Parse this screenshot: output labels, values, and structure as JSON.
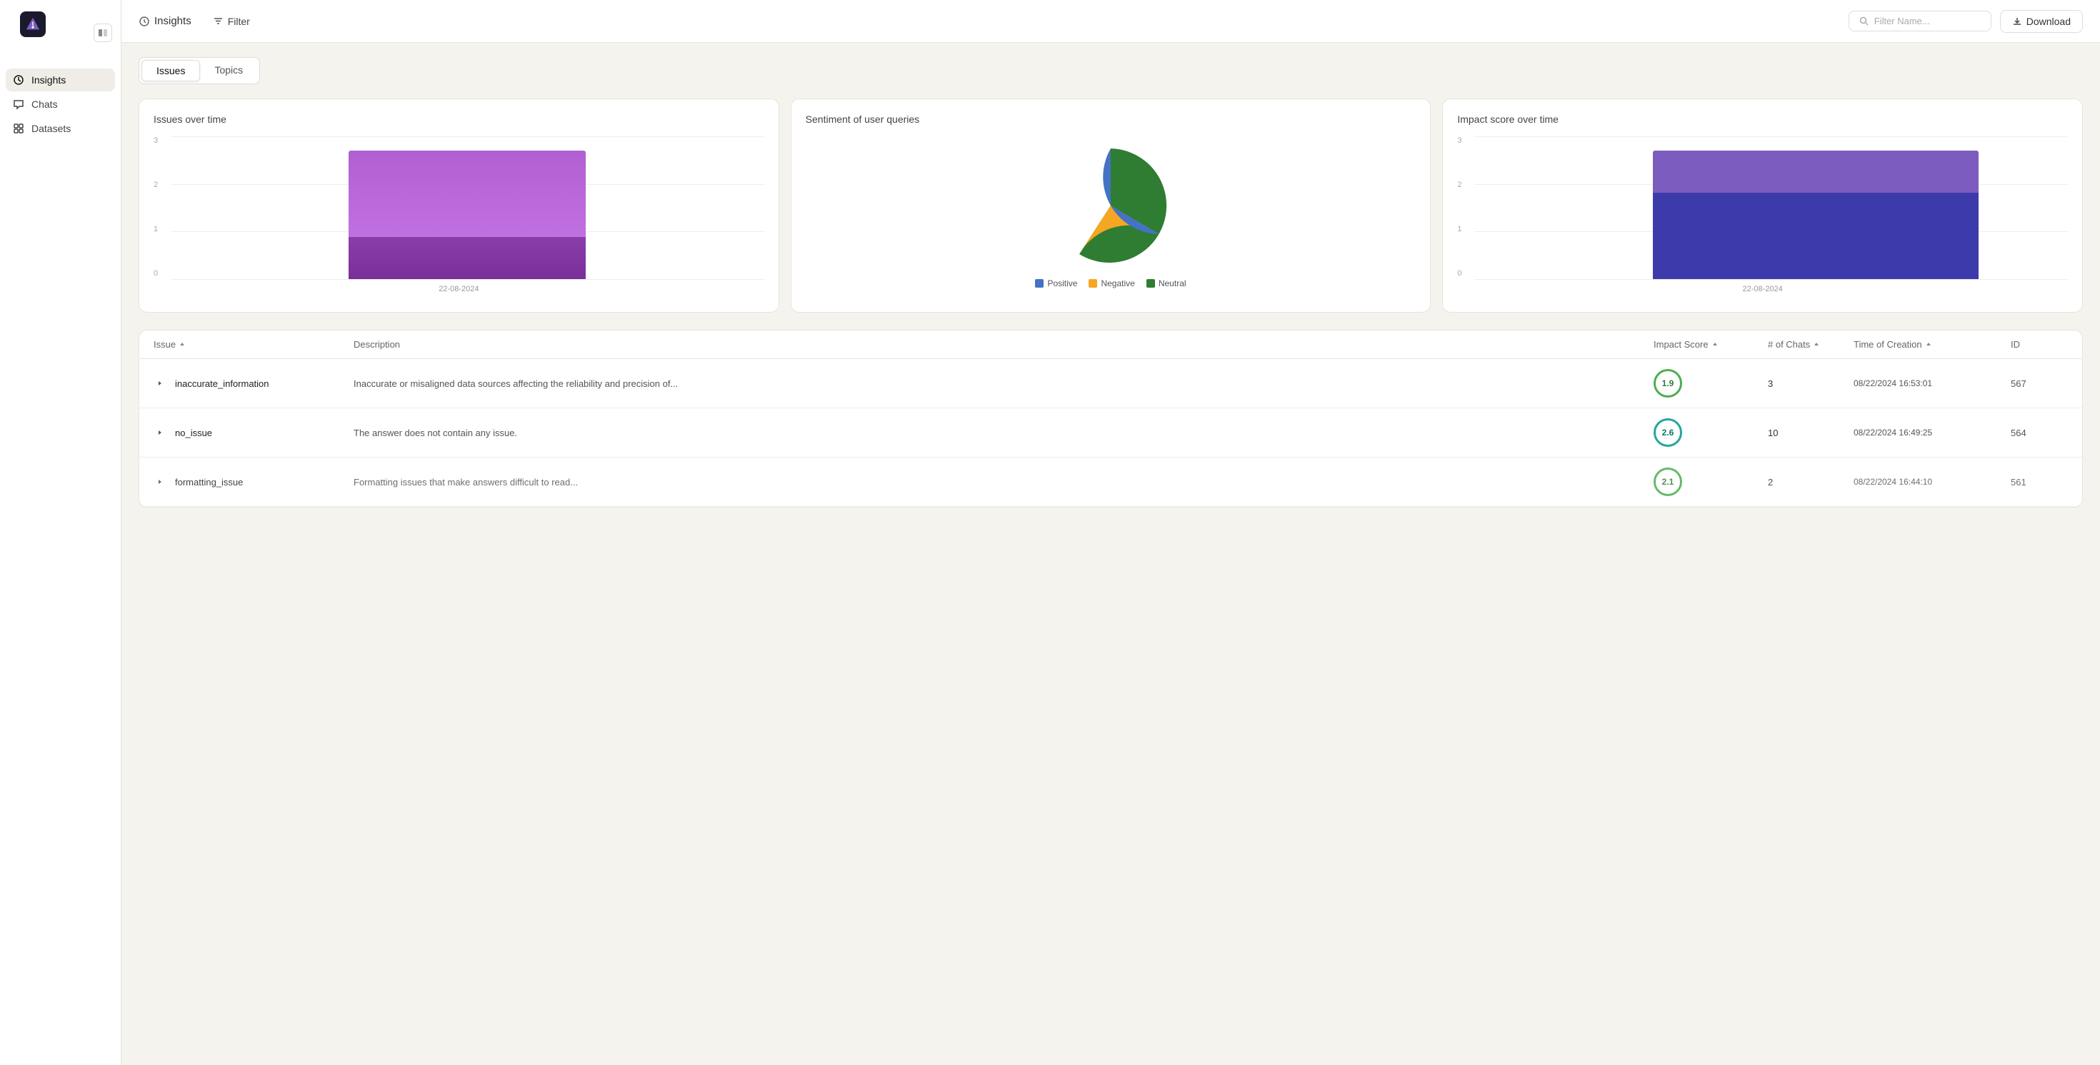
{
  "sidebar": {
    "logo_alt": "App Logo",
    "items": [
      {
        "id": "insights",
        "label": "Insights",
        "active": true
      },
      {
        "id": "chats",
        "label": "Chats",
        "active": false
      },
      {
        "id": "datasets",
        "label": "Datasets",
        "active": false
      }
    ]
  },
  "header": {
    "breadcrumb_icon": "insights-icon",
    "title": "Insights",
    "filter_label": "Filter",
    "filter_placeholder": "Filter Name...",
    "download_label": "Download"
  },
  "tabs": [
    {
      "id": "issues",
      "label": "Issues",
      "active": true
    },
    {
      "id": "topics",
      "label": "Topics",
      "active": false
    }
  ],
  "charts": {
    "issues_over_time": {
      "title": "Issues over time",
      "y_labels": [
        "3",
        "2",
        "1",
        "0"
      ],
      "bar_height_pct": 90,
      "x_label": "22-08-2024",
      "bar_color_top": "#b060d0",
      "bar_color_bottom": "#8a3fa8"
    },
    "sentiment": {
      "title": "Sentiment of user queries",
      "legend": [
        {
          "label": "Positive",
          "color": "#4472c4"
        },
        {
          "label": "Negative",
          "color": "#f5a623"
        },
        {
          "label": "Neutral",
          "color": "#2e7d32"
        }
      ]
    },
    "impact_score": {
      "title": "Impact score over time",
      "y_labels": [
        "3",
        "2",
        "1",
        "0"
      ],
      "x_label": "22-08-2024",
      "bar_color_top": "#7c5cbf",
      "bar_color_bottom": "#3d3bab"
    }
  },
  "table": {
    "columns": [
      {
        "key": "issue",
        "label": "Issue"
      },
      {
        "key": "description",
        "label": "Description"
      },
      {
        "key": "impact_score",
        "label": "Impact Score"
      },
      {
        "key": "num_chats",
        "label": "# of Chats"
      },
      {
        "key": "time_of_creation",
        "label": "Time of Creation"
      },
      {
        "key": "id",
        "label": "ID"
      }
    ],
    "rows": [
      {
        "issue": "inaccurate_information",
        "description": "Inaccurate or misaligned data sources affecting the reliability and precision of...",
        "impact_score": "1.9",
        "score_color": "green",
        "num_chats": 3,
        "time_of_creation": "08/22/2024 16:53:01",
        "id": "567"
      },
      {
        "issue": "no_issue",
        "description": "The answer does not contain any issue.",
        "impact_score": "2.6",
        "score_color": "teal",
        "num_chats": 10,
        "time_of_creation": "08/22/2024 16:49:25",
        "id": "564"
      },
      {
        "issue": "formatting_issue",
        "description": "Formatting issues that make answers difficult to read...",
        "impact_score": "2.1",
        "score_color": "green",
        "num_chats": 2,
        "time_of_creation": "08/22/2024 16:44:10",
        "id": "561"
      }
    ]
  }
}
